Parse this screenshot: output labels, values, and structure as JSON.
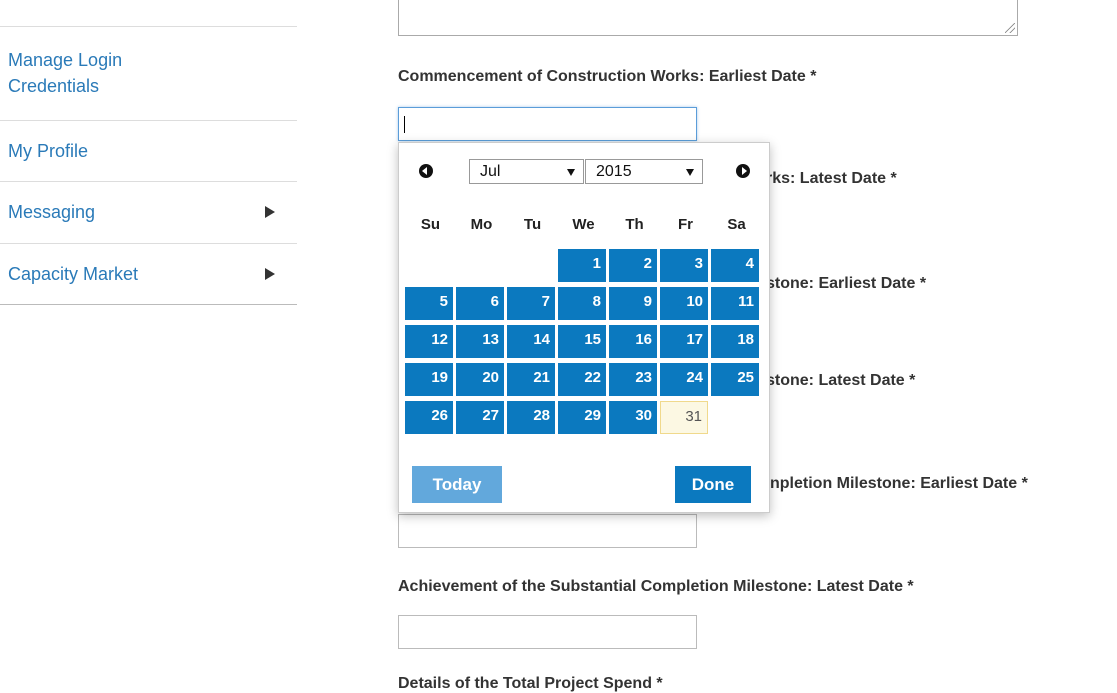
{
  "sidebar": {
    "items": [
      {
        "label": "Manage Login Credentials",
        "has_submenu": false
      },
      {
        "label": "My Profile",
        "has_submenu": false
      },
      {
        "label": "Messaging",
        "has_submenu": true
      },
      {
        "label": "Capacity Market",
        "has_submenu": true
      }
    ]
  },
  "form": {
    "labels": {
      "commencement_earliest": "Commencement of Construction Works: Earliest Date *",
      "commencement_latest": "Commencement of Construction Works: Latest Date *",
      "milestone_earliest": "Achievement of the Minimum Completion Milestone: Earliest Date *",
      "milestone_latest": "Achievement of the Minimum Completion Milestone: Latest Date *",
      "substantial_earliest": "Achievement of the Substantial Completion Milestone: Earliest Date *",
      "substantial_latest": "Achievement of the Substantial Completion Milestone: Latest Date *",
      "total_project_spend": "Details of the Total Project Spend *"
    },
    "visible_fragments": {
      "commencement_latest": "rks: Latest Date *",
      "milestone_earliest": "stone: Earliest Date *",
      "milestone_latest": "stone: Latest Date *",
      "substantial_earliest": "npletion Milestone: Earliest Date *"
    }
  },
  "datepicker": {
    "month": "Jul",
    "year": "2015",
    "weekdays": [
      "Su",
      "Mo",
      "Tu",
      "We",
      "Th",
      "Fr",
      "Sa"
    ],
    "first_weekday_index": 3,
    "days_in_month": 31,
    "today": 31,
    "today_button": "Today",
    "done_button": "Done",
    "colors": {
      "day_bg": "#0b79bf",
      "today_bg": "#fcf8e3",
      "today_btn": "#62a8dc"
    }
  }
}
